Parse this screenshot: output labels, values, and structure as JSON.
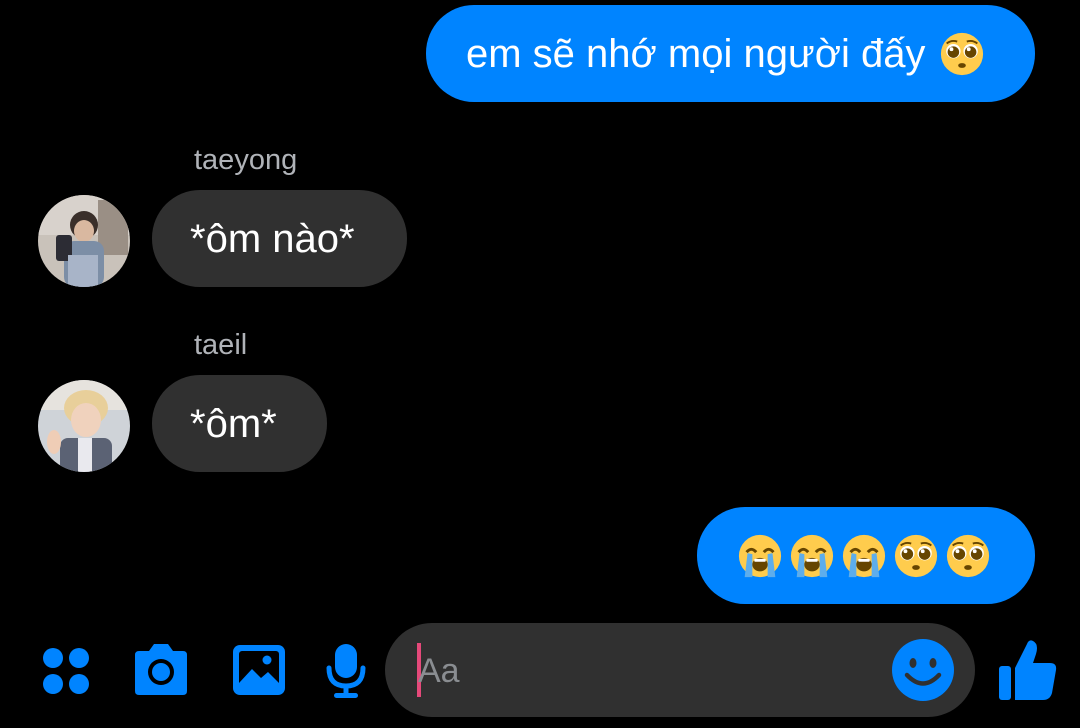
{
  "colors": {
    "accent": "#0084ff",
    "background": "#000000",
    "incoming_bubble": "#303030",
    "sender_name": "#b0b3b8",
    "caret": "#e5497a"
  },
  "messages": [
    {
      "direction": "outgoing",
      "text": "em sẽ nhớ mọi người đấy",
      "emoji": "pleading-face-emoji"
    },
    {
      "direction": "incoming",
      "sender": "taeyong",
      "text": "*ôm nào*"
    },
    {
      "direction": "incoming",
      "sender": "taeil",
      "text": "*ôm*"
    },
    {
      "direction": "outgoing",
      "emojis": [
        "loudly-crying-face-emoji",
        "loudly-crying-face-emoji",
        "loudly-crying-face-emoji",
        "pleading-face-emoji",
        "pleading-face-emoji"
      ]
    }
  ],
  "composer": {
    "placeholder": "Aa",
    "toolbar_icons": [
      "apps-grid-icon",
      "camera-icon",
      "image-gallery-icon",
      "microphone-icon"
    ],
    "emoji_button_icon": "smiley-face-icon",
    "send_icon": "thumbs-up-icon"
  }
}
